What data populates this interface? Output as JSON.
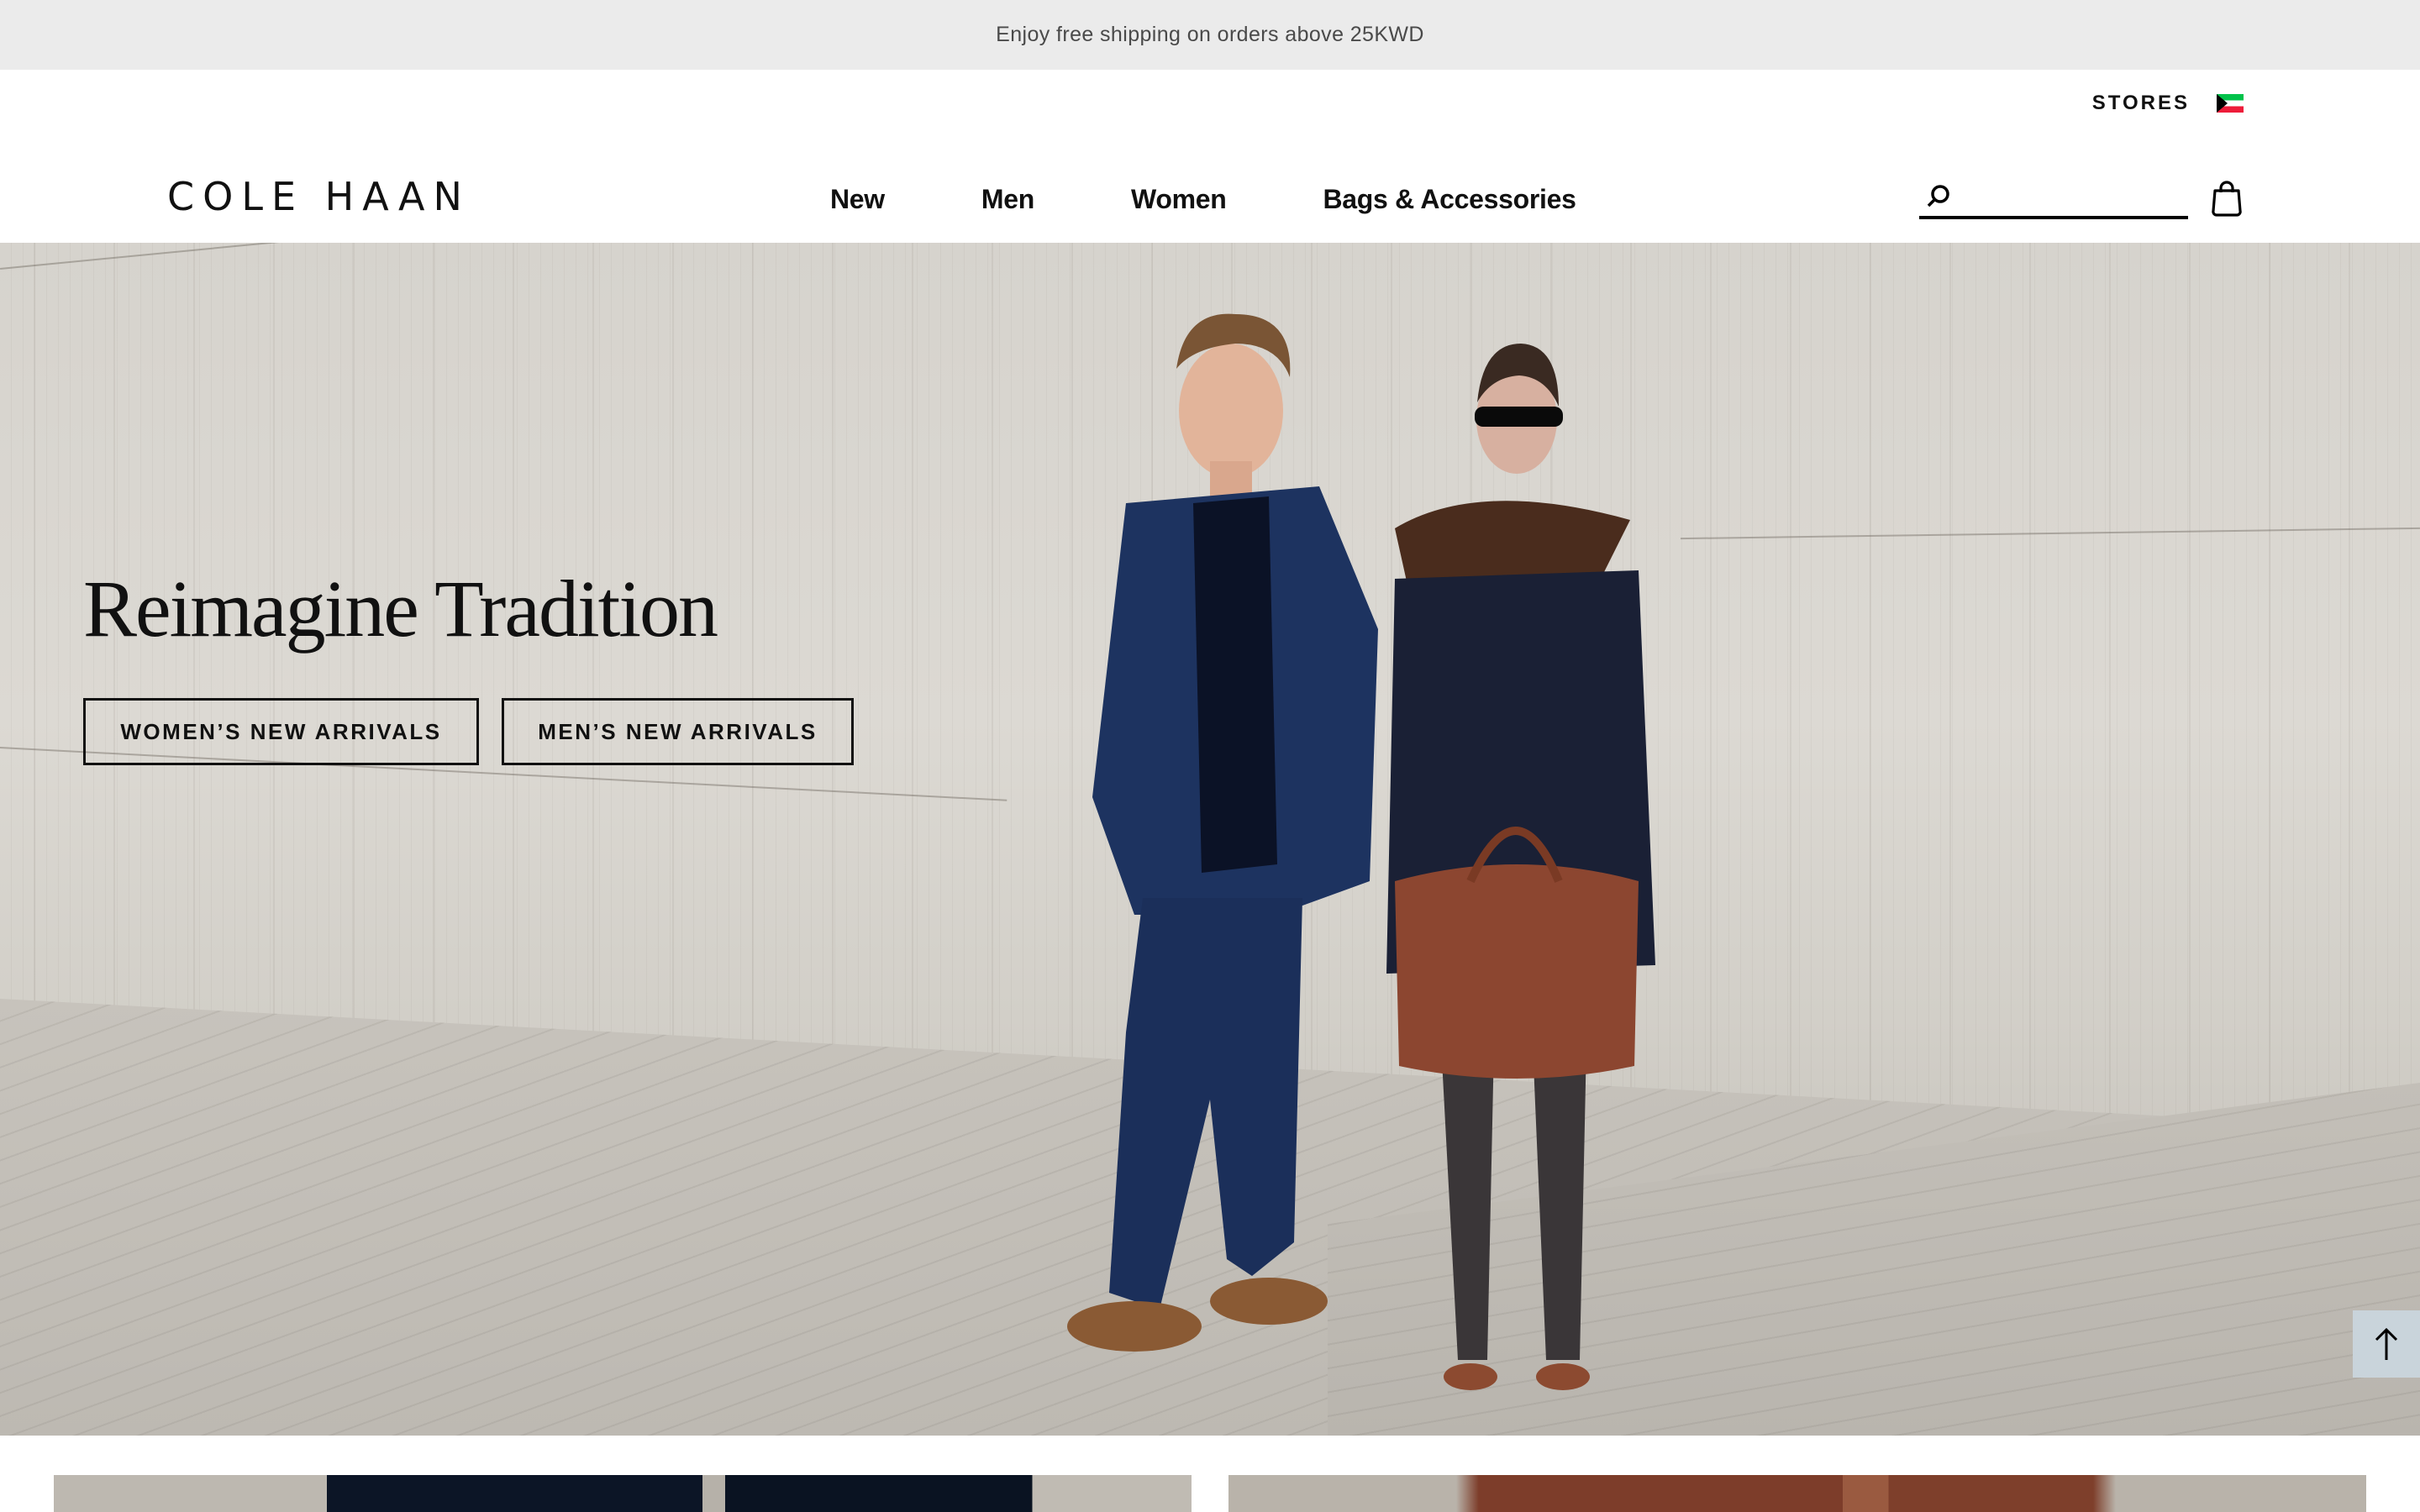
{
  "promo": {
    "text": "Enjoy free shipping on orders above 25KWD"
  },
  "header": {
    "utility": {
      "stores_label": "STORES",
      "country_flag": "kuwait-flag-icon"
    },
    "logo": "COLE HAAN",
    "nav": [
      {
        "label": "New"
      },
      {
        "label": "Men"
      },
      {
        "label": "Women"
      },
      {
        "label": "Bags & Accessories"
      }
    ],
    "search": {
      "value": "",
      "placeholder": "",
      "icon": "search-icon"
    },
    "cart": {
      "icon": "shopping-bag-icon"
    }
  },
  "hero": {
    "title": "Reimagine Tradition",
    "ctas": [
      {
        "label": "WOMEN’S NEW ARRIVALS"
      },
      {
        "label": "MEN’S NEW ARRIVALS"
      }
    ],
    "image_alt": "Man in navy jacket and trousers with brown suede shoes and woman in navy knit with brown scarf holding a woven brown leather tote, leaning against a travertine wall"
  },
  "scroll_top": {
    "icon": "arrow-up-icon"
  },
  "colors": {
    "promo_bg": "#ebebeb",
    "text": "#111111",
    "scroll_top_bg": "#c9d4db",
    "flag_green": "#00c24a",
    "flag_red": "#ee1c3a"
  }
}
